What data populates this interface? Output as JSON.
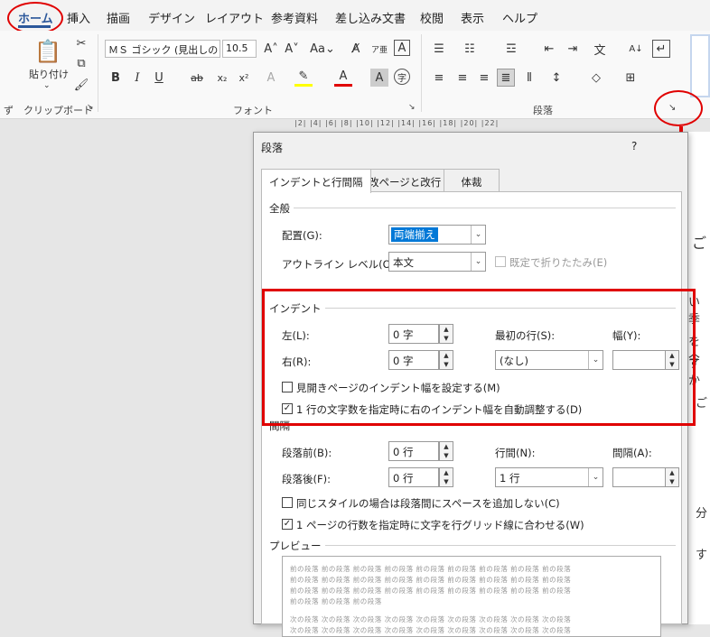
{
  "menubar": {
    "items": [
      "ホーム",
      "挿入",
      "描画",
      "デザイン",
      "レイアウト",
      "参考資料",
      "差し込み文書",
      "校閲",
      "表示",
      "ヘルプ"
    ]
  },
  "ribbon": {
    "paste_label": "貼り付け",
    "font_name": "ＭＳ ゴシック (見出しの",
    "font_size": "10.5",
    "clipboard_label": "クリップボード",
    "font_group_label": "フォント",
    "paragraph_group_label": "段落"
  },
  "ruler": "|2| |4| |6| |8| |10| |12| |14| |16| |18| |20| |22|",
  "doc_text": [
    "ご",
    "い季",
    "を今",
    "すか",
    "ご",
    "分",
    "す"
  ],
  "dialog": {
    "title": "段落",
    "help": "?",
    "tabs": [
      "インデントと行間隔",
      "改ページと改行",
      "体裁"
    ],
    "general": {
      "section": "全般",
      "alignment_label": "配置(G):",
      "alignment_value": "両端揃え",
      "outline_label": "アウトライン レベル(O):",
      "outline_value": "本文",
      "collapse_label": "既定で折りたたみ(E)"
    },
    "indent": {
      "section": "インデント",
      "left_label": "左(L):",
      "left_value": "0 字",
      "right_label": "右(R):",
      "right_value": "0 字",
      "first_line_label": "最初の行(S):",
      "first_line_value": "(なし)",
      "width_label": "幅(Y):",
      "width_value": "",
      "mirror_label": "見開きページのインデント幅を設定する(M)",
      "mirror_checked": false,
      "auto_adjust_label": "1 行の文字数を指定時に右のインデント幅を自動調整する(D)",
      "auto_adjust_checked": true
    },
    "spacing": {
      "section": "間隔",
      "before_label": "段落前(B):",
      "before_value": "0 行",
      "after_label": "段落後(F):",
      "after_value": "0 行",
      "line_spacing_label": "行間(N):",
      "line_spacing_value": "1 行",
      "at_label": "間隔(A):",
      "at_value": "",
      "no_space_label": "同じスタイルの場合は段落間にスペースを追加しない(C)",
      "no_space_checked": false,
      "grid_label": "1 ページの行数を指定時に文字を行グリッド線に合わせる(W)",
      "grid_checked": true
    },
    "preview": {
      "section": "プレビュー",
      "prev_line": "前の段落 前の段落 前の段落 前の段落 前の段落 前の段落 前の段落 前の段落 前の段落",
      "prev_line_short": "前の段落 前の段落 前の段落",
      "next_line": "次の段落 次の段落 次の段落 次の段落 次の段落 次の段落 次の段落 次の段落 次の段落"
    }
  },
  "colors": {
    "accent": "#2b579a",
    "annotation": "#e00000",
    "selection": "#0078d7"
  }
}
